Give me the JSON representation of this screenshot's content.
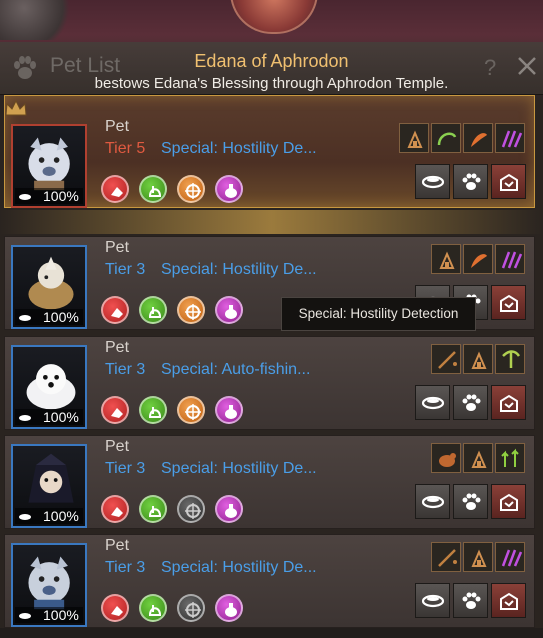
{
  "header": {
    "title": "Pet List",
    "buff_title": "Edana of Aphrodon",
    "buff_subtitle": "bestows Edana's Blessing through Aphrodon Temple.",
    "help_label": "?"
  },
  "pets": [
    {
      "name": "Pet",
      "tier": "Tier 5",
      "special": "Special: Hostility De...",
      "food": "100%",
      "featured": true,
      "skills": [
        "red",
        "green",
        "orange",
        "purple"
      ],
      "traits": [
        "dig",
        "sickle",
        "horn",
        "claw"
      ],
      "accent": "#e05a40"
    },
    {
      "name": "Pet",
      "tier": "Tier 3",
      "special": "Special: Hostility De...",
      "food": "100%",
      "featured": false,
      "skills": [
        "red",
        "green",
        "orange",
        "purple"
      ],
      "traits": [
        "dig",
        "horn",
        "claw"
      ],
      "accent": "#4a9ee8"
    },
    {
      "name": "Pet",
      "tier": "Tier 3",
      "special": "Special: Auto-fishin...",
      "food": "100%",
      "featured": false,
      "skills": [
        "red",
        "green",
        "orange",
        "purple"
      ],
      "traits": [
        "rod",
        "dig",
        "pick"
      ],
      "accent": "#4a9ee8"
    },
    {
      "name": "Pet",
      "tier": "Tier 3",
      "special": "Special: Hostility De...",
      "food": "100%",
      "featured": false,
      "skills": [
        "red",
        "green",
        "gray",
        "purple"
      ],
      "traits": [
        "bird",
        "dig",
        "arrows"
      ],
      "accent": "#4a9ee8"
    },
    {
      "name": "Pet",
      "tier": "Tier 3",
      "special": "Special: Hostility De...",
      "food": "100%",
      "featured": false,
      "skills": [
        "red",
        "green",
        "gray",
        "purple"
      ],
      "traits": [
        "rod",
        "dig",
        "claw"
      ],
      "accent": "#4a9ee8"
    }
  ],
  "tooltip": "Special: Hostility Detection",
  "icons": {
    "header": "paw-icon",
    "close": "close-icon",
    "crown": "crown-icon",
    "food": "food-bowl-icon",
    "actions": [
      "feed-bowl-icon",
      "paw-icon",
      "return-box-icon"
    ]
  },
  "colors": {
    "tier3": "#4a9ee8",
    "tier5": "#e05a40",
    "featured_border": "#c89840",
    "title_gold": "#f0c070"
  }
}
